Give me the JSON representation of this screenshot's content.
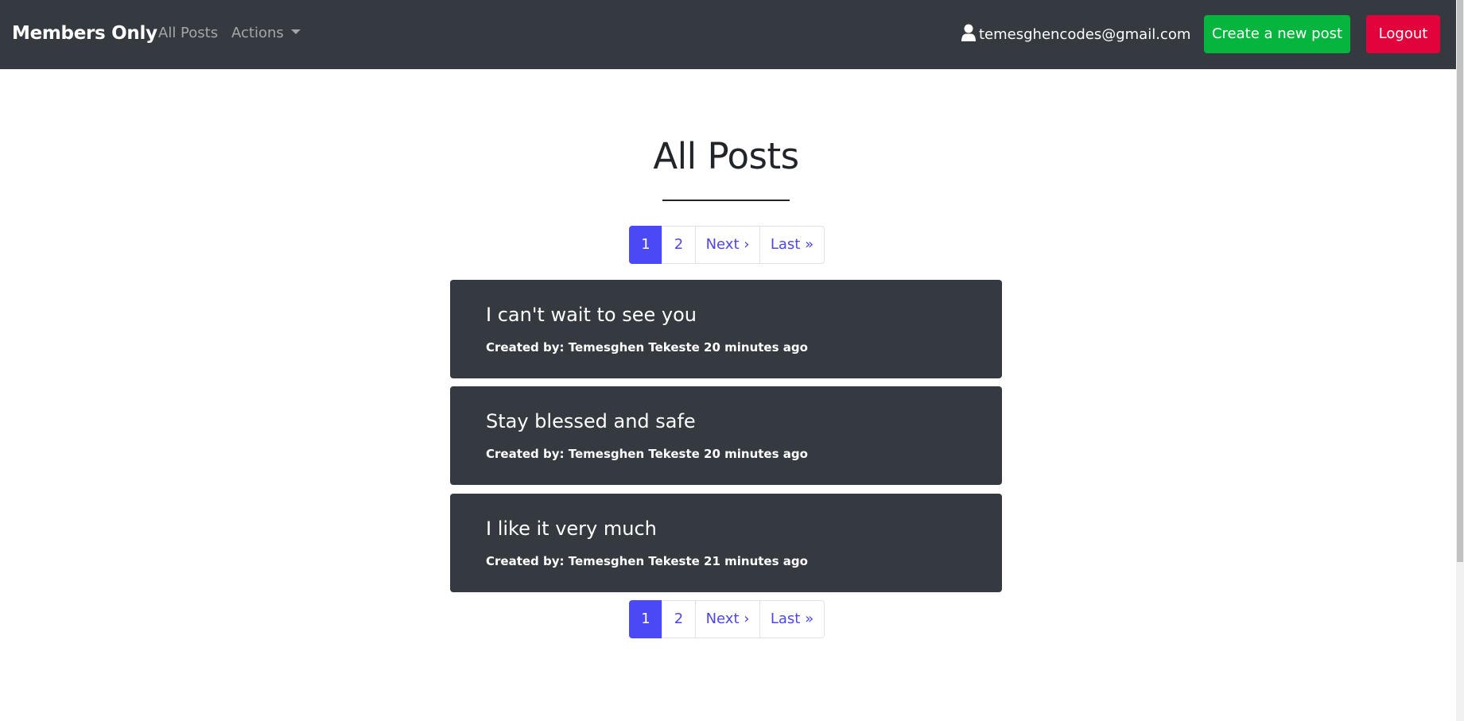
{
  "navbar": {
    "brand": "Members Only",
    "links": {
      "all_posts": "All Posts",
      "actions": "Actions"
    },
    "user_email": "temesghencodes@gmail.com",
    "create_button": "Create a new post",
    "logout_button": "Logout"
  },
  "page": {
    "title": "All Posts"
  },
  "pagination": {
    "pages": [
      "1",
      "2"
    ],
    "active_page": "1",
    "next_label": "Next ›",
    "last_label": "Last »"
  },
  "posts": [
    {
      "title": "I can't wait to see you",
      "meta": "Created by: Temesghen Tekeste 20 minutes ago"
    },
    {
      "title": "Stay blessed and safe",
      "meta": "Created by: Temesghen Tekeste 20 minutes ago"
    },
    {
      "title": "I like it very much",
      "meta": "Created by: Temesghen Tekeste 21 minutes ago"
    }
  ],
  "colors": {
    "navbar_bg": "#343a40",
    "create_button": "#06b53e",
    "logout_button": "#e2033d",
    "pagination_active": "#4b49f5",
    "pagination_link": "#4f46e5",
    "card_bg": "#343a40"
  },
  "icons": {
    "user": "user-icon",
    "dropdown": "caret-down-icon"
  }
}
